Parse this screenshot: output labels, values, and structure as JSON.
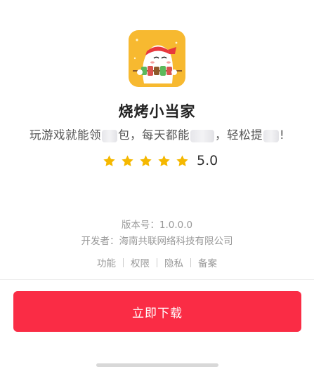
{
  "app": {
    "name": "烧烤小当家",
    "icon": "bbq-character-icon",
    "slogan_parts": [
      "玩游戏就能领",
      "包，每天都能",
      "，轻松提",
      "!"
    ],
    "rating": 5.0,
    "rating_text": "5.0",
    "stars": 5
  },
  "info": {
    "version": "版本号：1.0.0.0",
    "developer": "开发者：海南共联网络科技有限公司"
  },
  "links": [
    "功能",
    "权限",
    "隐私",
    "备案"
  ],
  "download_button": "立即下载",
  "colors": {
    "accent": "#fa2c45",
    "star": "#f5b800",
    "icon_background": "#f7b930"
  }
}
